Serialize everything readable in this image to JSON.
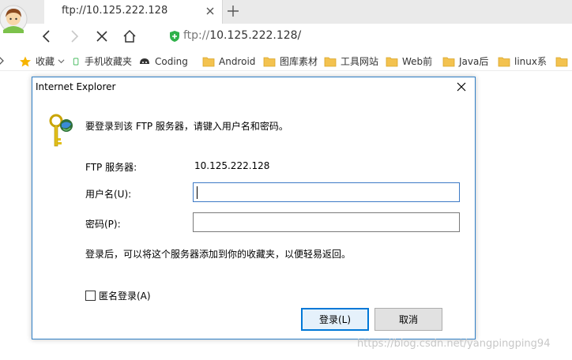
{
  "browser": {
    "tab": {
      "title": "ftp://10.125.222.128"
    },
    "address": {
      "protocol": "ftp://",
      "host": "10.125.222.128/"
    }
  },
  "bookmarks": [
    {
      "label": "收藏",
      "icon": "star-icon"
    },
    {
      "label": "手机收藏夹",
      "icon": "phone-icon"
    },
    {
      "label": "Coding",
      "icon": "coding-icon"
    },
    {
      "label": "Android",
      "icon": "folder-icon"
    },
    {
      "label": "图库素材",
      "icon": "folder-icon"
    },
    {
      "label": "工具网站",
      "icon": "folder-icon"
    },
    {
      "label": "Web前",
      "icon": "folder-icon"
    },
    {
      "label": "Java后",
      "icon": "folder-icon"
    },
    {
      "label": "linux系",
      "icon": "folder-icon"
    },
    {
      "label": "",
      "icon": "folder-icon"
    }
  ],
  "dialog": {
    "title": "Internet Explorer",
    "message": "要登录到该 FTP 服务器，请键入用户名和密码。",
    "server_label": "FTP 服务器:",
    "server_value": "10.125.222.128",
    "username_label": "用户名(U):",
    "username_value": "",
    "password_label": "密码(P):",
    "password_value": "",
    "note": "登录后，可以将这个服务器添加到你的收藏夹，以便轻易返回。",
    "anonymous_label": "匿名登录(A)",
    "anonymous_checked": false,
    "login_button": "登录(L)",
    "cancel_button": "取消"
  },
  "watermark": "https://blog.csdn.net/yangpingping94",
  "colors": {
    "dialog_border": "#2f7fc6",
    "accent": "#0078d7",
    "shield": "#2fb14a"
  }
}
